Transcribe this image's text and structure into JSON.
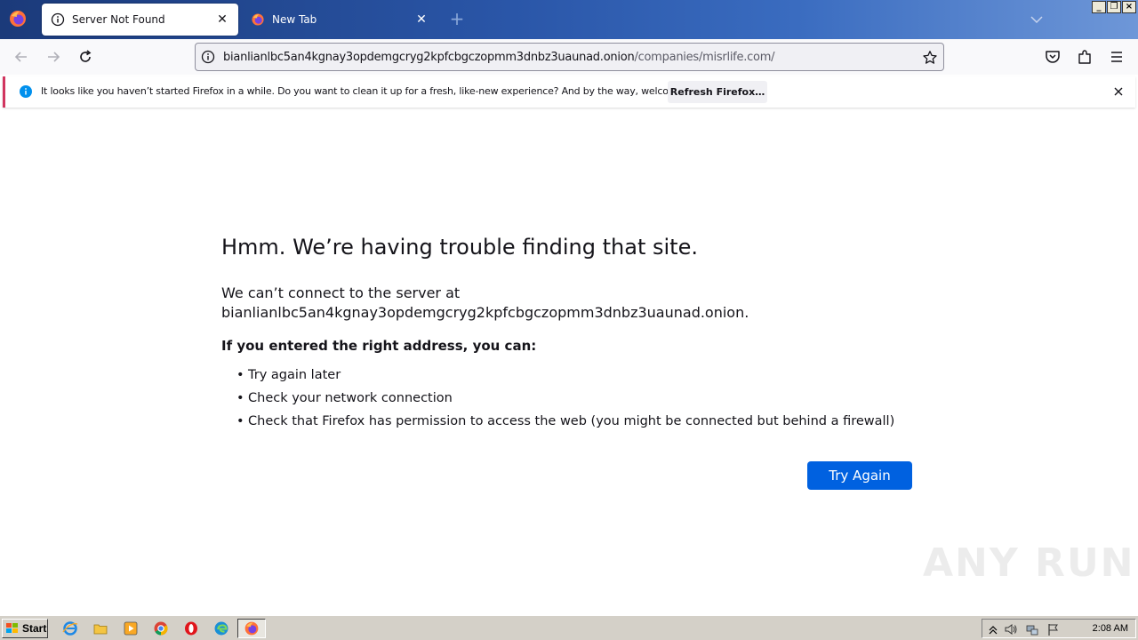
{
  "colors": {
    "accent": "#0061e0",
    "notice_border": "#d1355f",
    "tabstrip": "#2a56a8"
  },
  "tabs": [
    {
      "label": "Server Not Found",
      "icon": "info-icon",
      "active": true
    },
    {
      "label": "New Tab",
      "icon": "firefox-icon",
      "active": false
    }
  ],
  "window_controls": {
    "minimize": "_",
    "restore": "❐",
    "close": "×"
  },
  "navbar": {
    "url_host": "bianlianlbc5an4kgnay3opdemgcryg2kpfcbgczopmm3dnbz3uaunad.onion",
    "url_path": "/companies/misrlife.com/"
  },
  "notification": {
    "text": "It looks like you haven’t started Firefox in a while. Do you want to clean it up for a fresh, like-new experience? And by the way, welcome back!",
    "button": "Refresh Firefox…"
  },
  "error_page": {
    "title": "Hmm. We’re having trouble finding that site.",
    "message_line1": "We can’t connect to the server at",
    "message_line2": "bianlianlbc5an4kgnay3opdemgcryg2kpfcbgczopmm3dnbz3uaunad.onion.",
    "subtitle": "If you entered the right address, you can:",
    "suggestions": [
      "Try again later",
      "Check your network connection",
      "Check that Firefox has permission to access the web (you might be connected but behind a firewall)"
    ],
    "button": "Try Again"
  },
  "watermark": "ANY RUN",
  "taskbar": {
    "start_label": "Start",
    "clock": "2:08 AM"
  }
}
